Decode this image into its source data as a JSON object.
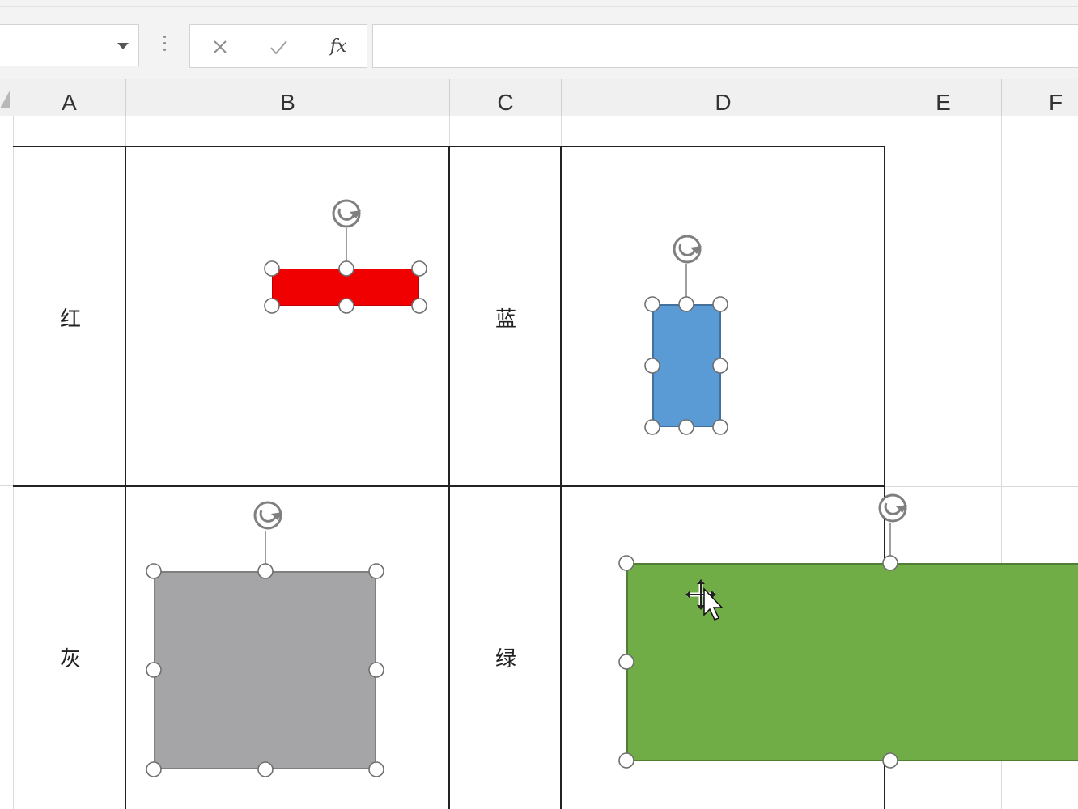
{
  "formula_bar": {
    "name_box_value": "",
    "cancel_icon": "cancel-x-icon",
    "enter_icon": "checkmark-icon",
    "fx_label": "fx",
    "formula_value": ""
  },
  "columns": [
    "A",
    "B",
    "C",
    "D",
    "E",
    "F"
  ],
  "labels": {
    "red": "红",
    "blue": "蓝",
    "gray": "灰",
    "green": "绿"
  },
  "shapes": {
    "red": {
      "color": "#f00000",
      "border": "#c00000"
    },
    "blue": {
      "color": "#5b9bd5",
      "border": "#41719c"
    },
    "gray": {
      "color": "#a5a5a7",
      "border": "#7f7f7f"
    },
    "green": {
      "color": "#70ad47",
      "border": "#507e32"
    }
  },
  "icons": {
    "rotate": "rotate-handle-icon",
    "cursor": "move-cursor-icon"
  }
}
